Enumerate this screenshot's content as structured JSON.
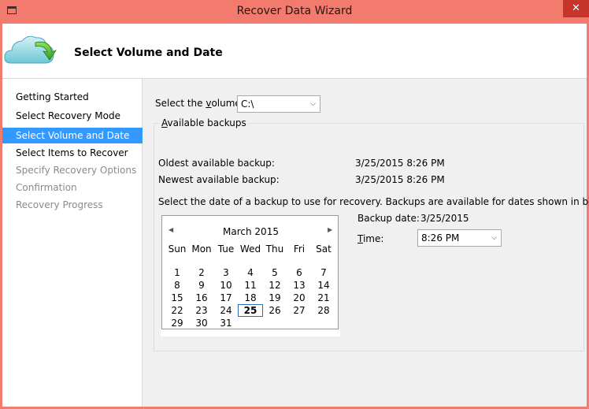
{
  "window": {
    "title": "Recover Data Wizard",
    "close_glyph": "✕"
  },
  "header": {
    "title": "Select Volume and Date",
    "icon": "cloud-recover-icon"
  },
  "nav": {
    "items": [
      {
        "label": "Getting Started",
        "state": "done"
      },
      {
        "label": "Select Recovery Mode",
        "state": "done"
      },
      {
        "label": "Select Volume and Date",
        "state": "active"
      },
      {
        "label": "Select Items to Recover",
        "state": "done"
      },
      {
        "label": "Specify Recovery Options",
        "state": "pending"
      },
      {
        "label": "Confirmation",
        "state": "pending"
      },
      {
        "label": "Recovery Progress",
        "state": "pending"
      }
    ]
  },
  "volume": {
    "label_pre": "Select the ",
    "label_key": "v",
    "label_post": "olume:",
    "selected": "C:\\"
  },
  "backups": {
    "group_key": "A",
    "group_rest": "vailable backups",
    "oldest_label": "Oldest available backup:",
    "oldest_value": "3/25/2015 8:26 PM",
    "newest_label": "Newest available backup:",
    "newest_value": "3/25/2015 8:26 PM",
    "instruction": "Select the date of a backup to use for recovery. Backups are available for dates shown in bold."
  },
  "calendar": {
    "month": "March 2015",
    "prev_glyph": "◀",
    "next_glyph": "▶",
    "weekdays": [
      "Sun",
      "Mon",
      "Tue",
      "Wed",
      "Thu",
      "Fri",
      "Sat"
    ],
    "first_weekday": 0,
    "days_in_month": 31,
    "selected_day": 25
  },
  "backup_date": {
    "label": "Backup date:",
    "value": "3/25/2015"
  },
  "time": {
    "label_key": "T",
    "label_rest": "ime:",
    "selected": "8:26 PM"
  },
  "colors": {
    "title_bar": "#f37b6e",
    "close_button": "#c7352a",
    "nav_active": "#3399ff"
  }
}
